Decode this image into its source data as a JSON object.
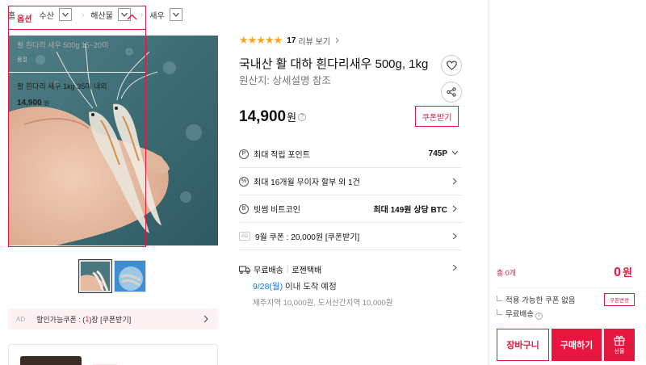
{
  "breadcrumb": {
    "home": "홈",
    "items": [
      "수산",
      "해산물",
      "새우"
    ]
  },
  "gallery": {
    "thumb_count": 2
  },
  "coupon_bar": {
    "ad": "AD",
    "prefix": "할인가능쿠폰 : (",
    "count": "1",
    "suffix": ")장 [쿠폰받기]"
  },
  "product": {
    "rating": 4.5,
    "stars": "★★★★★",
    "review_count": "17",
    "review_link": "리뷰 보기",
    "title": "국내산 활 대하 흰다리새우 500g, 1kg",
    "origin": "원산지:  상세설명 참조",
    "price": "14,900",
    "price_unit": "원",
    "coupon_button": "쿠폰받기"
  },
  "info_rows": [
    {
      "icon": "P",
      "label": "최대 적립 포인트",
      "value": "745P"
    },
    {
      "icon": "%",
      "label": "최대 16개월 무이자 할부 외 1건",
      "value": ""
    },
    {
      "icon": "B",
      "label": "빗썸 비트코인",
      "value": "최대 149원 상당 BTC"
    },
    {
      "icon": "AD",
      "label": "9월 쿠폰 : 20,000원 [쿠폰받기]",
      "value": ""
    }
  ],
  "shipping": {
    "free": "무료배송",
    "carrier": "로젠택배",
    "arrival_date": "9/28(월)",
    "arrival_text": " 이내 도착 예정",
    "extra": "제주지역 10,000원, 도서산간지역 10,000원"
  },
  "options": {
    "header": "옵션",
    "item1_name": "활 흰다리 새우 500g 15~20미",
    "item1_status": "품절",
    "item2_name": "활 흰다리 새우 1kg 35미 내외",
    "item2_price": "14,900",
    "item2_unit": "원"
  },
  "summary": {
    "total_label": "총 0개",
    "total_amount": "0",
    "total_unit": "원",
    "no_coupon": "적용 가능한 쿠폰 없음",
    "coupon_change": "쿠폰변경",
    "free_shipping": "무료배송"
  },
  "actions": {
    "cart": "장바구니",
    "buy": "구매하기",
    "gift": "선물"
  },
  "colors": {
    "accent": "#e8163f",
    "star": "#f5a623",
    "date_blue": "#1a73e8"
  }
}
